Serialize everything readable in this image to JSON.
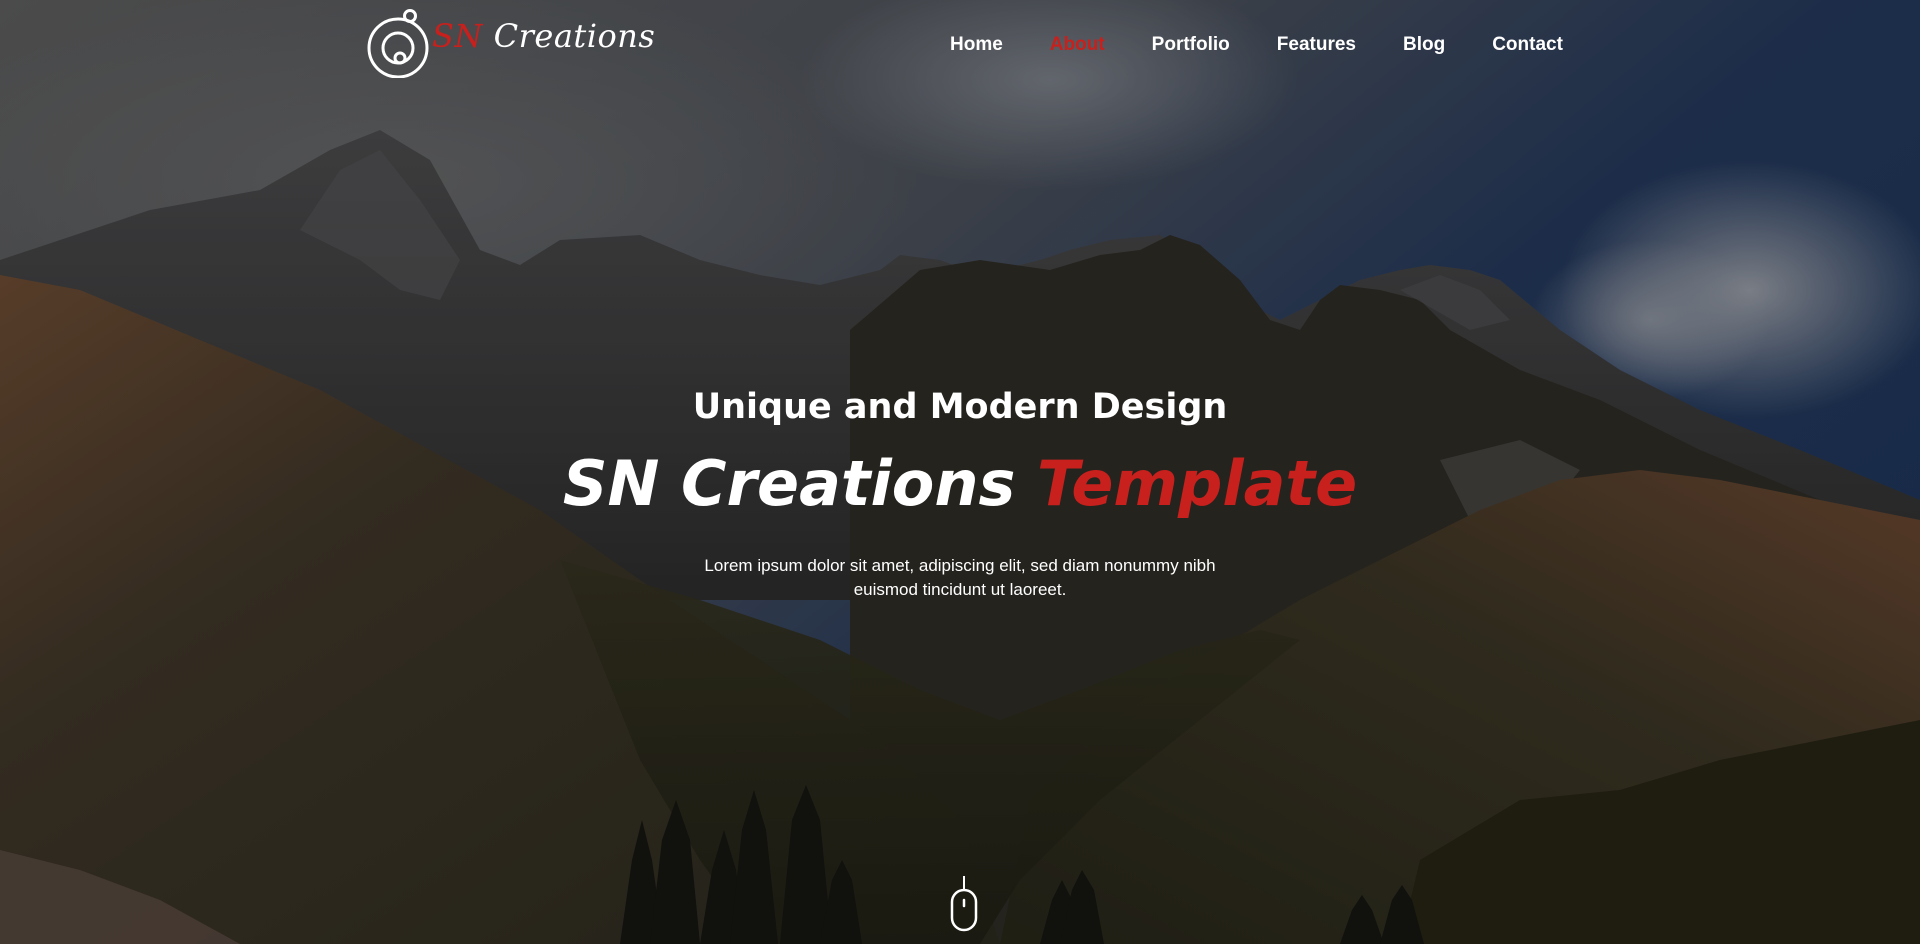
{
  "brand": {
    "logo_accent": "SN",
    "logo_rest": " Creations"
  },
  "nav": {
    "items": [
      {
        "label": "Home",
        "active": false
      },
      {
        "label": "About",
        "active": true
      },
      {
        "label": "Portfolio",
        "active": false
      },
      {
        "label": "Features",
        "active": false
      },
      {
        "label": "Blog",
        "active": false
      },
      {
        "label": "Contact",
        "active": false
      }
    ]
  },
  "hero": {
    "subtitle": "Unique and Modern Design",
    "headline_main": "SN Creations",
    "headline_accent": "Template",
    "description": "Lorem ipsum dolor sit amet, adipiscing elit, sed diam nonummy nibh euismod tincidunt ut laoreet."
  },
  "icons": {
    "logo": "planet-ring-logo-icon",
    "scroll": "mouse-scroll-icon"
  },
  "colors": {
    "accent": "#c8201c",
    "text": "#ffffff"
  }
}
